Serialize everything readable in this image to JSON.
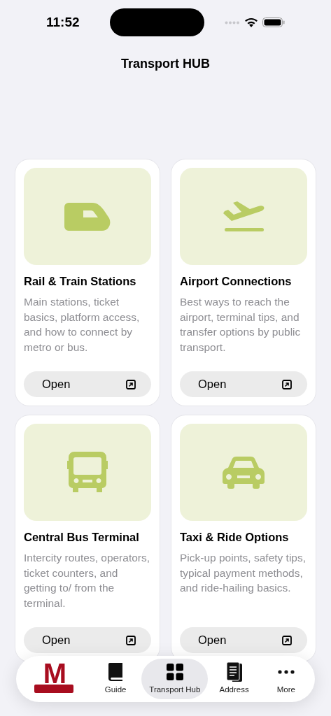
{
  "status_bar": {
    "time": "11:52"
  },
  "title": "Transport HUB",
  "cards": [
    {
      "kind": "train",
      "title": "Rail & Train Stations",
      "description": "Main stations, ticket basics, platform access, and how to connect by metro or bus.",
      "button": "Open"
    },
    {
      "kind": "plane",
      "title": "Airport Connections",
      "description": "Best ways to reach the airport, terminal tips, and transfer options by public transport.",
      "button": "Open"
    },
    {
      "kind": "bus",
      "title": "Central Bus Terminal",
      "description": "Intercity routes, operators, ticket counters, and getting to/ from the terminal.",
      "button": "Open"
    },
    {
      "kind": "car",
      "title": "Taxi & Ride Options",
      "description": "Pick-up points, safety tips, typical payment methods, and ride-hailing basics.",
      "button": "Open"
    }
  ],
  "tab_bar": {
    "logo": "M",
    "tabs": [
      {
        "kind": "book",
        "label": "Guide",
        "selected": false
      },
      {
        "kind": "grid",
        "label": "Transport Hub",
        "selected": true
      },
      {
        "kind": "document",
        "label": "Address",
        "selected": false
      },
      {
        "kind": "more",
        "label": "More",
        "selected": false
      }
    ]
  }
}
